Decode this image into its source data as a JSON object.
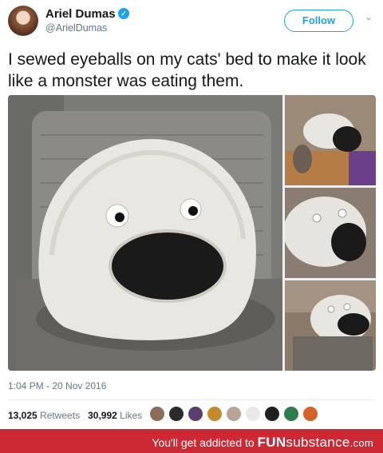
{
  "user": {
    "display_name": "Ariel Dumas",
    "handle": "@ArielDumas",
    "verified_mark": "✓"
  },
  "actions": {
    "follow_label": "Follow",
    "caret_glyph": "⌄"
  },
  "tweet": {
    "text": "I sewed eyeballs on my cats' bed to make it look like a monster was eating them.",
    "timestamp": "1:04 PM - 20 Nov 2016"
  },
  "stats": {
    "retweets_count": "13,025",
    "retweets_label": "Retweets",
    "likes_count": "30,992",
    "likes_label": "Likes"
  },
  "footer": {
    "tagline": "You'll get addicted to",
    "brand_strong": "FUN",
    "brand_light": "substance",
    "brand_tld": ".com"
  },
  "colors": {
    "accent": "#1da1f2",
    "footer_bg": "#cc2934"
  }
}
